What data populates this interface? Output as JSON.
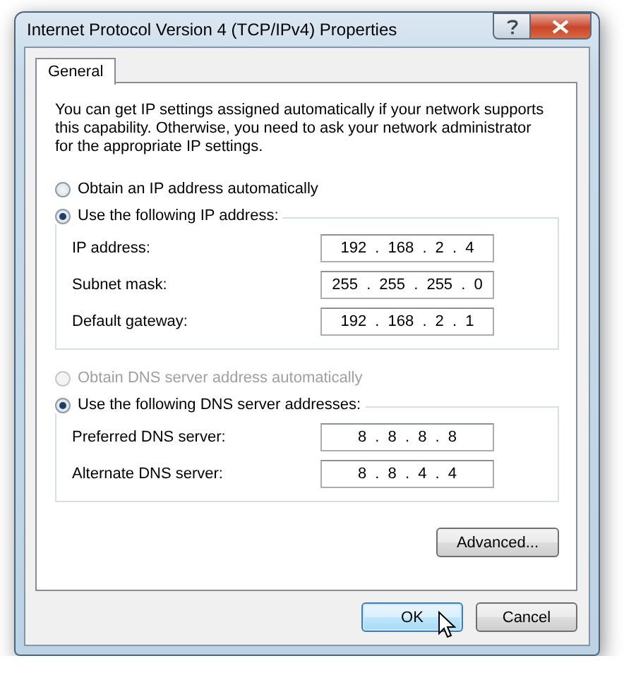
{
  "window": {
    "title": "Internet Protocol Version 4 (TCP/IPv4) Properties"
  },
  "tabs": [
    {
      "label": "General",
      "selected": true
    }
  ],
  "description": "You can get IP settings assigned automatically if your network supports this capability. Otherwise, you need to ask your network administrator for the appropriate IP settings.",
  "ip_options": [
    {
      "label": "Obtain an IP address automatically",
      "selected": false,
      "disabled": false
    },
    {
      "label": "Use the following IP address:",
      "selected": true,
      "disabled": false
    }
  ],
  "ip_fields": [
    {
      "label": "IP address:",
      "value": "192 . 168 . 2 . 4"
    },
    {
      "label": "Subnet mask:",
      "value": "255 . 255 . 255 . 0"
    },
    {
      "label": "Default gateway:",
      "value": "192 . 168 . 2 . 1"
    }
  ],
  "dns_options": [
    {
      "label": "Obtain DNS server address automatically",
      "selected": false,
      "disabled": true
    },
    {
      "label": "Use the following DNS server addresses:",
      "selected": true,
      "disabled": false
    }
  ],
  "dns_fields": [
    {
      "label": "Preferred DNS server:",
      "value": "8 . 8 . 8 . 8"
    },
    {
      "label": "Alternate DNS server:",
      "value": "8 . 8 . 4 . 4"
    }
  ],
  "advanced_button": "Advanced...",
  "buttons": [
    {
      "label": "OK",
      "default": true
    },
    {
      "label": "Cancel",
      "default": false
    }
  ]
}
